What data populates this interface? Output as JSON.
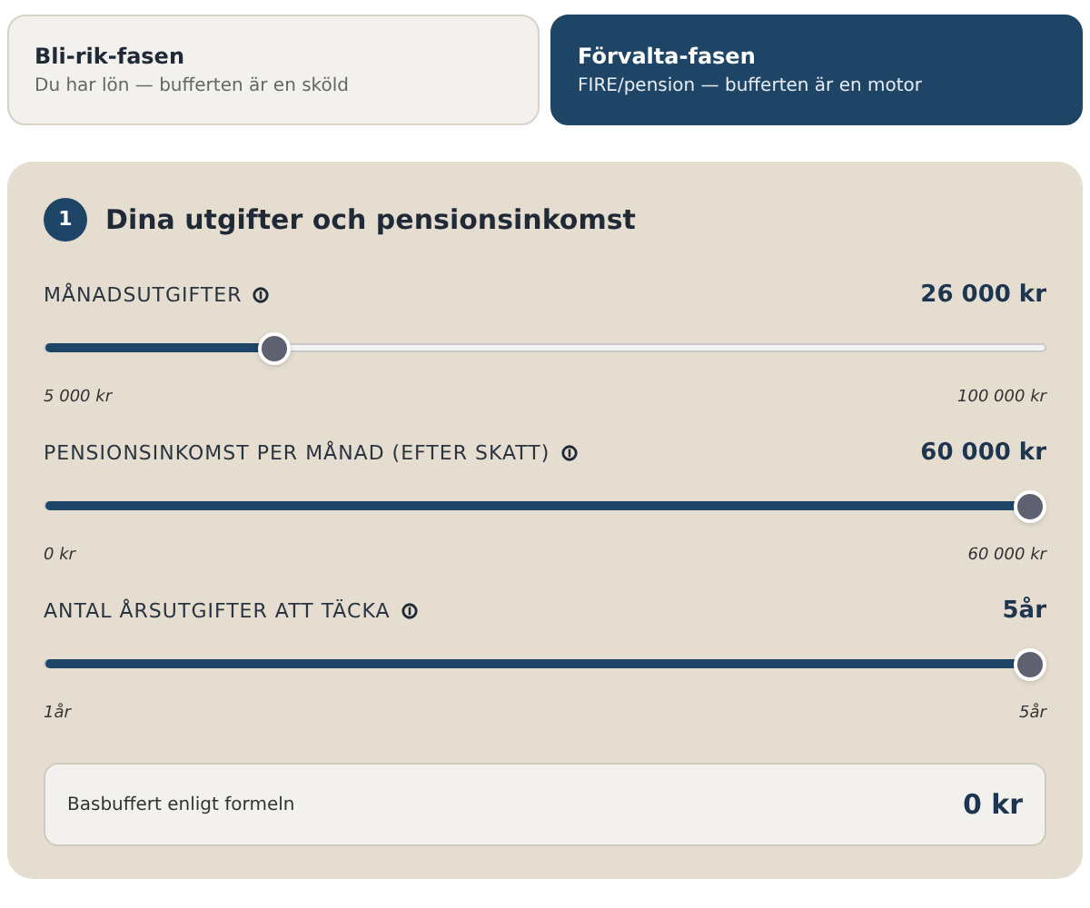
{
  "phases": [
    {
      "title": "Bli-rik-fasen",
      "subtitle": "Du har lön — bufferten är en sköld",
      "selected": false
    },
    {
      "title": "Förvalta-fasen",
      "subtitle": "FIRE/pension — bufferten är en motor",
      "selected": true
    }
  ],
  "section": {
    "step": "1",
    "title": "Dina utgifter och pensionsinkomst",
    "sliders": [
      {
        "label": "MÅNADSUTGIFTER",
        "value": "26 000 kr",
        "level": 0.221,
        "min": "5 000 kr",
        "max": "100 000 kr"
      },
      {
        "label": "PENSIONSINKOMST PER MÅNAD (EFTER SKATT)",
        "value": "60 000 kr",
        "level": 1,
        "min": "0 kr",
        "max": "60 000 kr"
      },
      {
        "label": "ANTAL ÅRSUTGIFTER ATT TÄCKA",
        "value": "5år",
        "level": 1,
        "min": "1år",
        "max": "5år"
      }
    ],
    "result": {
      "label": "Basbuffert enligt formeln",
      "value": "0 kr"
    }
  }
}
